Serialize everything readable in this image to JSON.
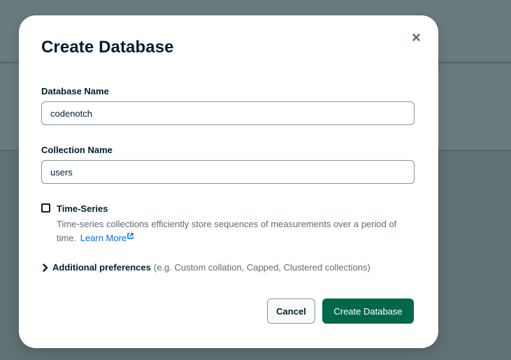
{
  "dialog": {
    "title": "Create Database",
    "close_icon": "close-icon",
    "database_name": {
      "label": "Database Name",
      "value": "codenotch"
    },
    "collection_name": {
      "label": "Collection Name",
      "value": "users"
    },
    "time_series": {
      "label": "Time-Series",
      "checked": false,
      "description": "Time-series collections efficiently store sequences of measurements over a period of time.",
      "learn_more": "Learn More",
      "external_icon": "external-link-icon"
    },
    "additional_preferences": {
      "label": "Additional preferences",
      "hint": "(e.g. Custom collation, Capped, Clustered collections)",
      "icon": "chevron-right-icon"
    },
    "buttons": {
      "cancel": "Cancel",
      "create": "Create Database"
    }
  },
  "colors": {
    "primary_button": "#00684a",
    "link": "#016bf8",
    "text": "#001e2b",
    "backdrop": "#5f7175"
  }
}
